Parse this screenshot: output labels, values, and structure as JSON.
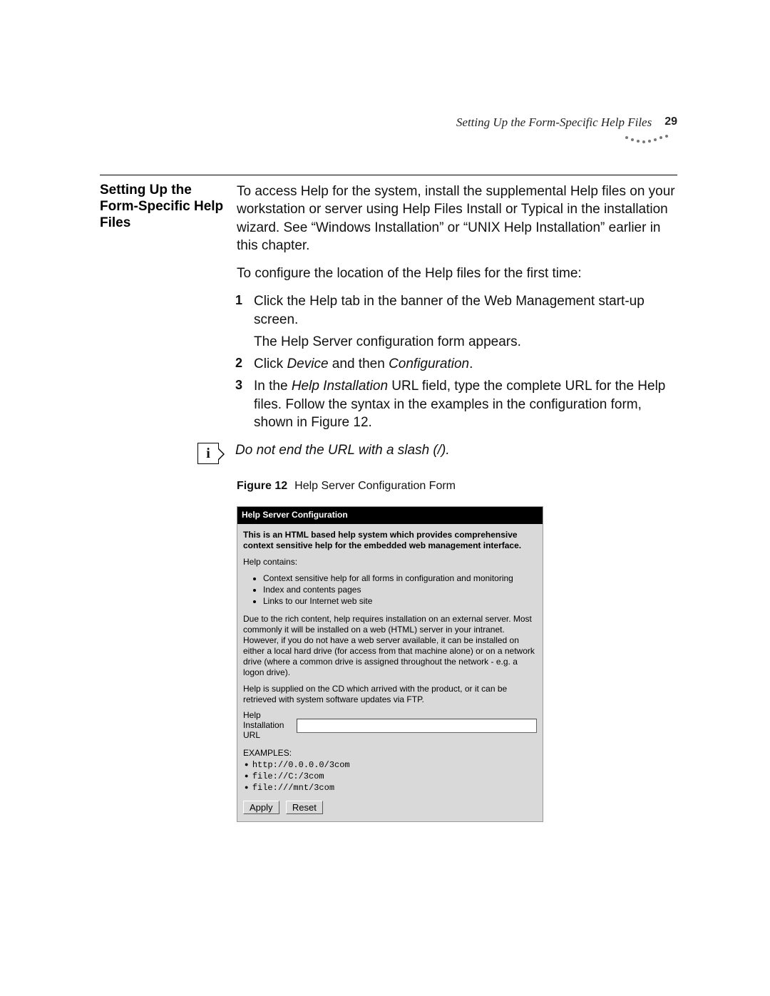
{
  "header": {
    "runningTitle": "Setting Up the Form-Specific Help Files",
    "pageNumber": "29"
  },
  "sectionHeading": "Setting Up the Form-Specific Help Files",
  "intro1": "To access Help for the system, install the supplemental Help files on your workstation or server using Help Files Install or Typical in the installation wizard. See “Windows Installation” or “UNIX Help Installation” earlier in this chapter.",
  "intro2": "To configure the location of the Help files for the first time:",
  "steps": [
    {
      "n": "1",
      "text": "Click the Help tab in the banner of the Web Management start-up screen.",
      "aux": "The Help Server configuration form appears."
    },
    {
      "n": "2",
      "pre": "Click ",
      "em1": "Device",
      "mid": " and then ",
      "em2": "Configuration",
      "post": "."
    },
    {
      "n": "3",
      "pre": "In the ",
      "em1": "Help Installation",
      "post": " URL field, type the complete URL for the Help files. Follow the syntax in the examples in the configuration form, shown in Figure 12."
    }
  ],
  "note": "Do not end the URL with a slash (/).",
  "figure": {
    "label": "Figure 12",
    "caption": "Help Server Configuration Form"
  },
  "screenshot": {
    "title": "Help Server Configuration",
    "intro": "This is an HTML based help system which provides comprehensive context sensitive help for the embedded web management interface.",
    "containsLabel": "Help contains:",
    "bullets": [
      "Context sensitive help for all forms in configuration and monitoring",
      "Index and contents pages",
      "Links to our Internet web site"
    ],
    "para1": "Due to the rich content, help requires installation on an external server. Most commonly it will be installed on a web (HTML) server in your intranet. However, if you do not have a web server available, it can be installed on either a local hard drive (for access from that machine alone) or on a network drive (where a common drive is assigned throughout the network - e.g. a logon drive).",
    "para2": "Help is supplied on the CD which arrived with the product, or it can be retrieved with system software updates via FTP.",
    "fieldLabel": "Help Installation URL",
    "fieldValue": "",
    "examplesLabel": "EXAMPLES:",
    "examples": [
      "http://0.0.0.0/3com",
      "file://C:/3com",
      "file:///mnt/3com"
    ],
    "applyLabel": "Apply",
    "resetLabel": "Reset"
  }
}
